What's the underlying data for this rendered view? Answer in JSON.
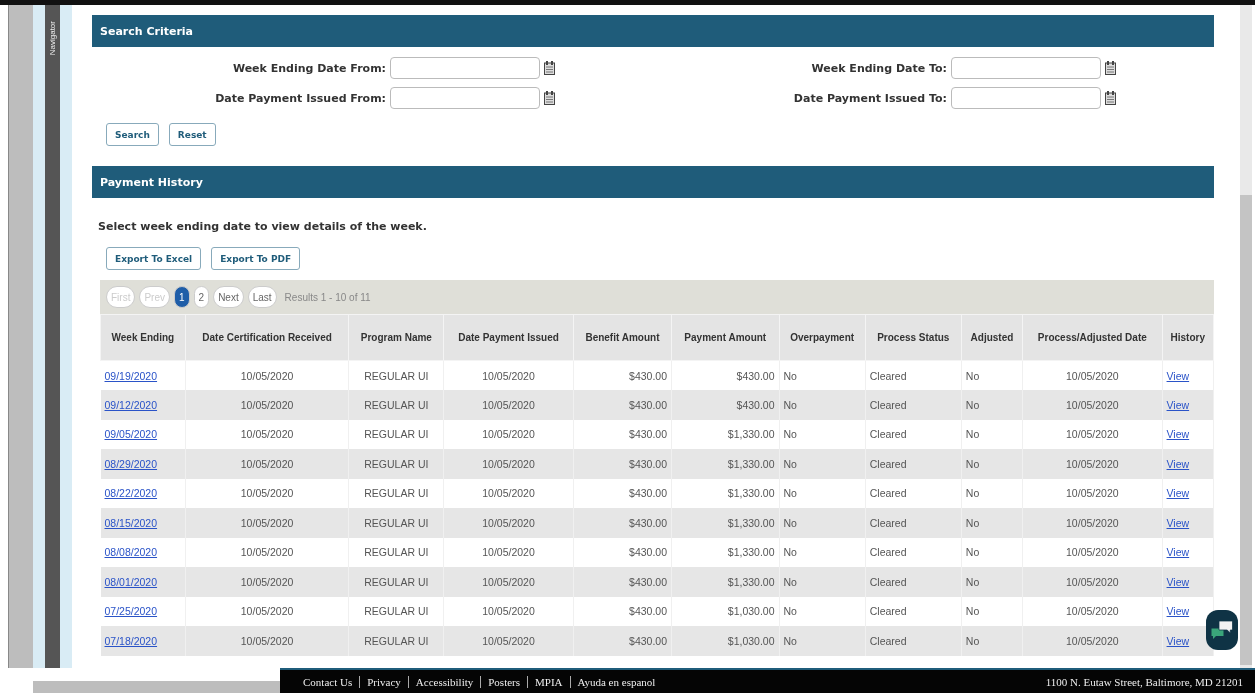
{
  "navigator": {
    "label": "Navigator"
  },
  "search_criteria": {
    "title": "Search Criteria",
    "fields": [
      {
        "label": "Week Ending Date From:"
      },
      {
        "label": "Week Ending Date To:"
      },
      {
        "label": "Date Payment Issued From:"
      },
      {
        "label": "Date Payment Issued To:"
      }
    ],
    "buttons": [
      "Search",
      "Reset"
    ]
  },
  "payment_history": {
    "title": "Payment History",
    "instruction": "Select week ending date to view details of the week.",
    "buttons": [
      "Export To Excel",
      "Export To PDF"
    ],
    "pager": [
      {
        "label": "First",
        "kind": "nav",
        "disabled": true,
        "selected": false
      },
      {
        "label": "Prev",
        "kind": "nav",
        "disabled": true,
        "selected": false
      },
      {
        "label": "1",
        "kind": "page",
        "disabled": false,
        "selected": true
      },
      {
        "label": "2",
        "kind": "page",
        "disabled": false,
        "selected": false
      },
      {
        "label": "Next",
        "kind": "nav",
        "disabled": false,
        "selected": false
      },
      {
        "label": "Last",
        "kind": "nav",
        "disabled": false,
        "selected": false
      }
    ],
    "results": "Results 1 - 10 of 11",
    "table": {
      "columns": [
        {
          "label": "Week Ending",
          "kind": "link"
        },
        {
          "label": "Date Certification Received",
          "kind": "center"
        },
        {
          "label": "Program Name",
          "kind": "center"
        },
        {
          "label": "Date Payment Issued",
          "kind": "center"
        },
        {
          "label": "Benefit Amount",
          "kind": "right"
        },
        {
          "label": "Payment Amount",
          "kind": "right"
        },
        {
          "label": "Overpayment",
          "kind": "left"
        },
        {
          "label": "Process Status",
          "kind": "left"
        },
        {
          "label": "Adjusted",
          "kind": "left"
        },
        {
          "label": "Process/Adjusted Date",
          "kind": "center"
        },
        {
          "label": "History",
          "kind": "link"
        }
      ],
      "rows": [
        [
          "09/19/2020",
          "10/05/2020",
          "REGULAR UI",
          "10/05/2020",
          "$430.00",
          "$430.00",
          "No",
          "Cleared",
          "No",
          "10/05/2020",
          "View"
        ],
        [
          "09/12/2020",
          "10/05/2020",
          "REGULAR UI",
          "10/05/2020",
          "$430.00",
          "$430.00",
          "No",
          "Cleared",
          "No",
          "10/05/2020",
          "View"
        ],
        [
          "09/05/2020",
          "10/05/2020",
          "REGULAR UI",
          "10/05/2020",
          "$430.00",
          "$1,330.00",
          "No",
          "Cleared",
          "No",
          "10/05/2020",
          "View"
        ],
        [
          "08/29/2020",
          "10/05/2020",
          "REGULAR UI",
          "10/05/2020",
          "$430.00",
          "$1,330.00",
          "No",
          "Cleared",
          "No",
          "10/05/2020",
          "View"
        ],
        [
          "08/22/2020",
          "10/05/2020",
          "REGULAR UI",
          "10/05/2020",
          "$430.00",
          "$1,330.00",
          "No",
          "Cleared",
          "No",
          "10/05/2020",
          "View"
        ],
        [
          "08/15/2020",
          "10/05/2020",
          "REGULAR UI",
          "10/05/2020",
          "$430.00",
          "$1,330.00",
          "No",
          "Cleared",
          "No",
          "10/05/2020",
          "View"
        ],
        [
          "08/08/2020",
          "10/05/2020",
          "REGULAR UI",
          "10/05/2020",
          "$430.00",
          "$1,330.00",
          "No",
          "Cleared",
          "No",
          "10/05/2020",
          "View"
        ],
        [
          "08/01/2020",
          "10/05/2020",
          "REGULAR UI",
          "10/05/2020",
          "$430.00",
          "$1,330.00",
          "No",
          "Cleared",
          "No",
          "10/05/2020",
          "View"
        ],
        [
          "07/25/2020",
          "10/05/2020",
          "REGULAR UI",
          "10/05/2020",
          "$430.00",
          "$1,030.00",
          "No",
          "Cleared",
          "No",
          "10/05/2020",
          "View"
        ],
        [
          "07/18/2020",
          "10/05/2020",
          "REGULAR UI",
          "10/05/2020",
          "$430.00",
          "$1,030.00",
          "No",
          "Cleared",
          "No",
          "10/05/2020",
          "View"
        ]
      ]
    }
  },
  "footer": {
    "links": [
      "Contact Us",
      "Privacy",
      "Accessibility",
      "Posters",
      "MPIA",
      "Ayuda en espanol"
    ],
    "address": "1100 N. Eutaw Street, Baltimore, MD 21201"
  }
}
